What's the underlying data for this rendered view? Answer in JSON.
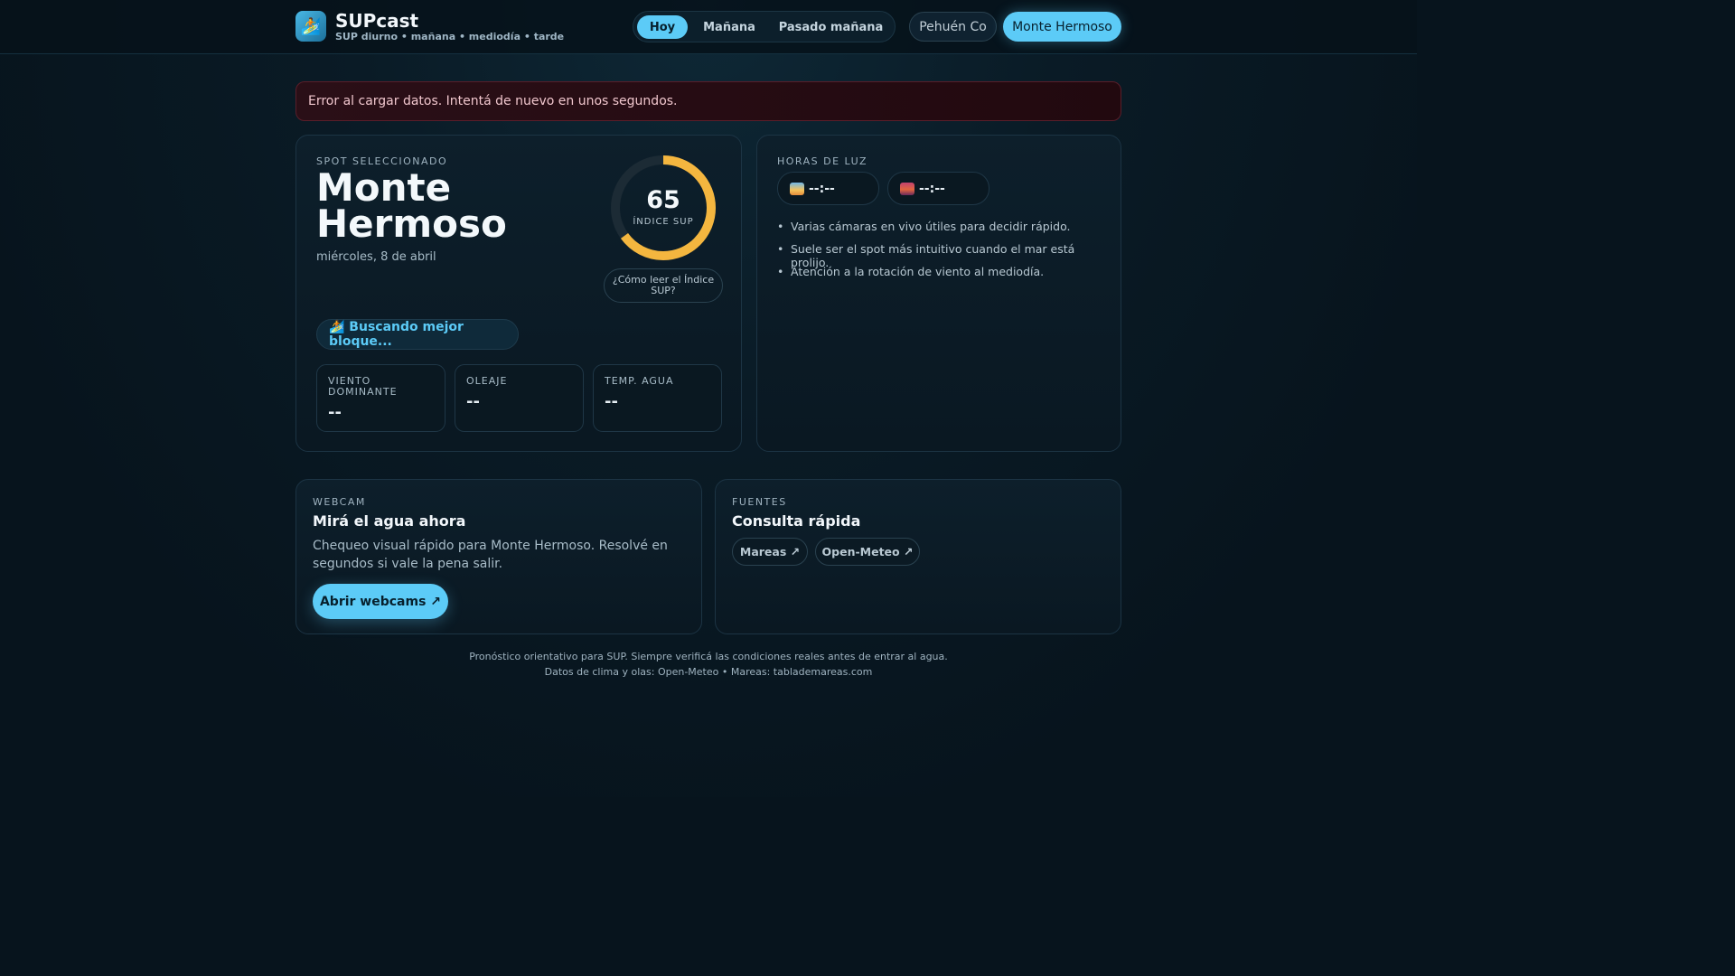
{
  "header": {
    "brand_title": "SUPcast",
    "brand_subtitle": "SUP diurno • mañana • mediodía • tarde",
    "logo_icon": "surfer-icon",
    "day_tabs": [
      "Hoy",
      "Mañana",
      "Pasado mañana"
    ],
    "active_day_tab": "Hoy",
    "spots": [
      "Pehuén Co",
      "Monte Hermoso"
    ],
    "active_spot": "Monte Hermoso"
  },
  "error_message": "Error al cargar datos. Intentá de nuevo en unos segundos.",
  "spot_card": {
    "eyebrow": "SPOT SELECCIONADO",
    "name_line1": "Monte",
    "name_line2": "Hermoso",
    "date": "miércoles, 8 de abril",
    "sup_index": {
      "value": "65",
      "fill_fraction": 0.65,
      "label": "ÍNDICE SUP",
      "help": "¿Cómo leer el Índice SUP?",
      "color": "#f4b63f"
    },
    "best_block": "🏄 Buscando mejor bloque...",
    "stats": [
      {
        "label": "VIENTO DOMINANTE",
        "value": "--"
      },
      {
        "label": "OLEAJE",
        "value": "--"
      },
      {
        "label": "TEMP. AGUA",
        "value": "--"
      }
    ]
  },
  "daylight_card": {
    "eyebrow": "HORAS DE LUZ",
    "sunrise": "--:--",
    "sunset": "--:--",
    "sunrise_icon": "sunrise-icon",
    "sunset_icon": "sunset-icon",
    "tips": [
      "Varias cámaras en vivo útiles para decidir rápido.",
      "Suele ser el spot más intuitivo cuando el mar está prolijo.",
      "Atención a la rotación de viento al mediodía."
    ]
  },
  "webcam_card": {
    "eyebrow": "WEBCAM",
    "title": "Mirá el agua ahora",
    "description": "Chequeo visual rápido para Monte Hermoso. Resolvé en segundos si vale la pena salir.",
    "button": "Abrir webcams ↗"
  },
  "sources_card": {
    "eyebrow": "FUENTES",
    "title": "Consulta rápida",
    "links": [
      "Mareas ↗",
      "Open-Meteo ↗"
    ]
  },
  "footer": {
    "line1": "Pronóstico orientativo para SUP. Siempre verificá las condiciones reales antes de entrar al agua.",
    "line2": "Datos de clima y olas: Open-Meteo • Mareas: tablademareas.com"
  },
  "colors": {
    "accent": "#5ccbf7",
    "background": "#07141d",
    "error_bg": "#2a0f17",
    "gauge_track": "#1c2b35"
  }
}
